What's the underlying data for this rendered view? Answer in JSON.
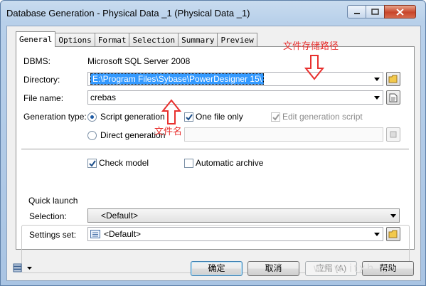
{
  "window": {
    "title": "Database Generation - Physical Data _1 (Physical Data _1)"
  },
  "tabs": [
    "General",
    "Options",
    "Format",
    "Selection",
    "Summary",
    "Preview"
  ],
  "form": {
    "dbms_label": "DBMS:",
    "dbms_value": "Microsoft SQL Server 2008",
    "directory_label": "Directory:",
    "directory_value": "E:\\Program Files\\Sybase\\PowerDesigner 15\\",
    "filename_label": "File name:",
    "filename_value": "crebas",
    "generation_type_label": "Generation type:",
    "script_generation": "Script generation",
    "direct_generation": "Direct generation",
    "one_file_only": "One file only",
    "edit_generation_script": "Edit generation script",
    "check_model": "Check model",
    "automatic_archive": "Automatic archive"
  },
  "quick_launch": {
    "title": "Quick launch",
    "selection_label": "Selection:",
    "selection_value": "<Default>",
    "settings_label": "Settings set:",
    "settings_value": "<Default>"
  },
  "buttons": {
    "ok": "确定",
    "cancel": "取消",
    "apply": "应用 (A)",
    "help": "帮助"
  },
  "annotations": {
    "directory_note": "文件存储路径",
    "filename_note": "文件名"
  },
  "watermark": "www.itxh.cc",
  "colors": {
    "annotation": "#e8302e",
    "selection_highlight": "#3399ff"
  }
}
